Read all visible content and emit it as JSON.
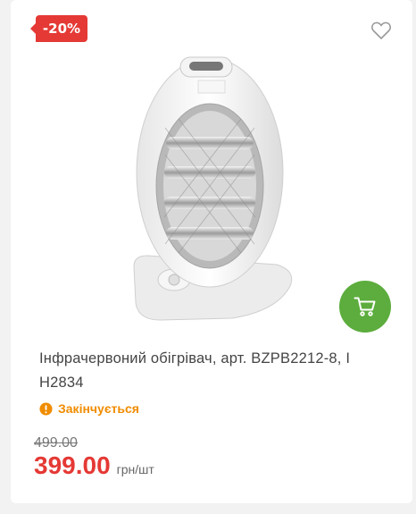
{
  "product": {
    "discount_badge": "-20%",
    "title": "Інфрачервоний обігрівач, арт. BZPB2212-8, І H2834",
    "availability": "Закінчується",
    "old_price": "499.00",
    "price": "399.00",
    "unit": "грн/шт"
  },
  "icons": {
    "wishlist": "heart-outline-icon",
    "cart": "shopping-cart-icon",
    "availability": "warning-circle-icon"
  },
  "colors": {
    "badge": "#e53935",
    "price": "#e53935",
    "cart_button": "#5cad3d",
    "availability": "#f08c00"
  }
}
